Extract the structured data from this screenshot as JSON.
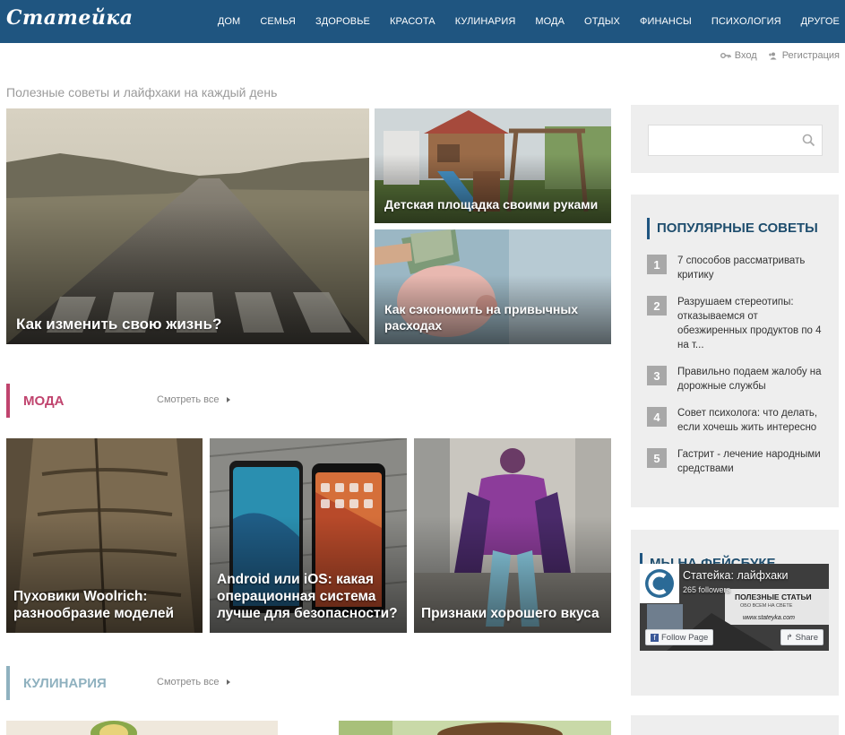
{
  "site": {
    "logo": "Статейка"
  },
  "nav": [
    "Дом",
    "Семья",
    "Здоровье",
    "Красота",
    "Кулинария",
    "Мода",
    "Отдых",
    "Финансы",
    "Психология",
    "Другое"
  ],
  "auth": {
    "login": "Вход",
    "register": "Регистрация"
  },
  "tagline": "Полезные советы и лайфхаки на каждый день",
  "featured": [
    {
      "title": "Как изменить свою жизнь?"
    },
    {
      "title": "Детская площадка своими руками"
    },
    {
      "title": "Как сэкономить на привычных расходах"
    }
  ],
  "sections": [
    {
      "name": "Мода",
      "see_all": "Смотреть все",
      "color": "#c0446e",
      "posts": [
        {
          "title": "Пуховики Woolrich: разнообразие моделей"
        },
        {
          "title": "Android или iOS: какая операционная система лучше для безопасности?"
        },
        {
          "title": "Признаки хорошего вкуса"
        }
      ]
    },
    {
      "name": "Кулинария",
      "see_all": "Смотреть все",
      "color": "#8fb1bf"
    }
  ],
  "sidebar": {
    "popular_title": "Популярные советы",
    "popular": [
      {
        "num": "1",
        "text": "7 способов рассматривать критику"
      },
      {
        "num": "2",
        "text": "Разрушаем стереотипы: отказываемся от обезжиренных продуктов по 4 на т..."
      },
      {
        "num": "3",
        "text": "Правильно подаем жалобу на дорожные службы"
      },
      {
        "num": "4",
        "text": "Совет психолога: что делать, если хочешь жить интересно"
      },
      {
        "num": "5",
        "text": "Гастрит - лечение народными средствами"
      }
    ],
    "facebook_title": "Мы на фейсбуке",
    "fb_page": "Статейка: лайфхаки",
    "fb_followers": "265 followers",
    "fb_banner": "ПОЛЕЗНЫЕ СТАТЬИ",
    "fb_banner_sub": "ОБО ВСЕМ НА СВЕТЕ",
    "fb_url": "www.stateyka.com",
    "fb_follow": "Follow Page",
    "fb_share": "Share"
  }
}
